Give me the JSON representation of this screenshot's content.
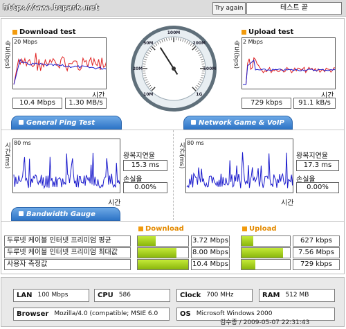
{
  "header": {
    "url": "http://www.bcpark.net",
    "try_again_label": "Try again",
    "test_end_label": "테스트 끝"
  },
  "download": {
    "title": "Download test",
    "y_axis_label": "속도(bps)",
    "scale_label": "20 Mbps",
    "x_axis_label": "시간",
    "value_mbps": "10.4 Mbps",
    "value_mbs": "1.30 MB/s"
  },
  "upload": {
    "title": "Upload test",
    "y_axis_label": "속도(bps)",
    "scale_label": "2 Mbps",
    "x_axis_label": "시간",
    "value_kbps": "729 kbps",
    "value_kbs": "91.1 kB/s"
  },
  "gauge": {
    "labels": [
      "10M",
      "20M",
      "50M",
      "100M",
      "200M",
      "500M",
      "1G"
    ],
    "needle_fraction": 0.38
  },
  "ping": {
    "tab_label": "General Ping Test",
    "y_axis_label": "시간(ms)",
    "scale_label": "80 ms",
    "x_axis_label": "시간",
    "rtt_label": "왕복지연율",
    "rtt_value": "15.3 ms",
    "loss_label": "손실율",
    "loss_value": "0.00%"
  },
  "game": {
    "tab_label": "Network Game & VoIP Test",
    "y_axis_label": "시간(ms)",
    "scale_label": "80 ms",
    "x_axis_label": "시간",
    "rtt_label": "왕복지연율",
    "rtt_value": "17.3 ms",
    "loss_label": "손실율",
    "loss_value": "0.00%"
  },
  "bandwidth": {
    "tab_label": "Bandwidth Gauge",
    "download_header": "Download",
    "upload_header": "Upload",
    "rows": [
      {
        "label": "두루넷 케이블 인터넷 프리미엄 평균",
        "download": "3.72 Mbps",
        "download_fraction": 0.36,
        "upload": "627 kbps",
        "upload_fraction": 0.24
      },
      {
        "label": "두루넷 케이블 인터넷 프리미엄 최대값",
        "download": "8.00 Mbps",
        "download_fraction": 0.77,
        "upload": "7.56 Mbps",
        "upload_fraction": 0.86
      },
      {
        "label": "사용자 측정값",
        "download": "10.4 Mbps",
        "download_fraction": 1.0,
        "upload": "729 kbps",
        "upload_fraction": 0.28
      }
    ]
  },
  "system": {
    "lan_label": "LAN",
    "lan_value": "100 Mbps",
    "cpu_label": "CPU",
    "cpu_value": "586",
    "clock_label": "Clock",
    "clock_value": "700 MHz",
    "ram_label": "RAM",
    "ram_value": "512 MB",
    "browser_label": "Browser",
    "browser_value": "Mozilla/4.0 (compatible; MSIE 6.0",
    "os_label": "OS",
    "os_value": "Microsoft Windows 2000"
  },
  "credit": "김수종 / 2009-05-07 22:31:43",
  "colors": {
    "accent": "#f29b0d",
    "tab_blue": "#2d74c6",
    "series_red": "#e02020",
    "series_blue": "#1a1acc",
    "bar_green": "#9fcc14"
  }
}
